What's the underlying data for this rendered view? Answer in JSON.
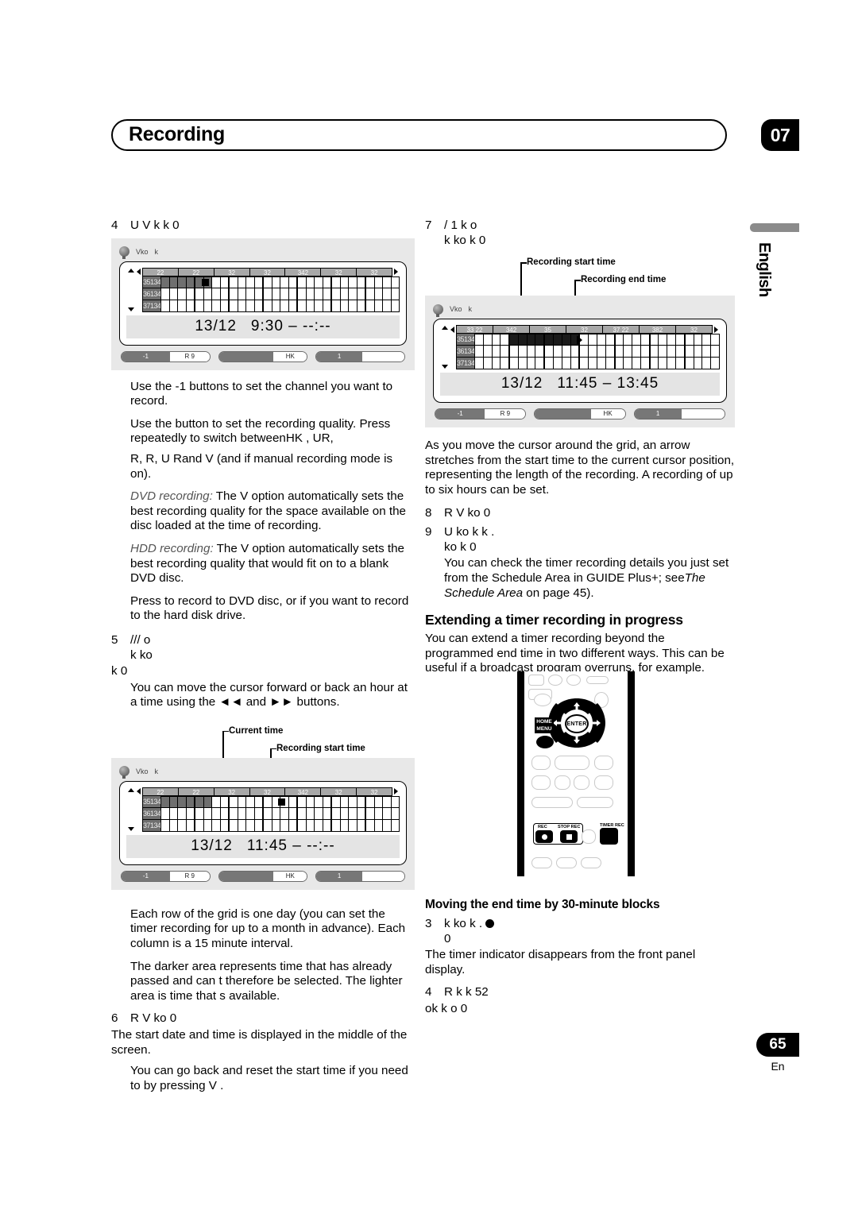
{
  "header": {
    "chapter_title": "Recording",
    "chapter_number": "07",
    "language_tab": "English"
  },
  "footer": {
    "page_number": "65",
    "page_language": "En"
  },
  "left_column": {
    "step4": {
      "number": "4",
      "text_line1": "U          V                                        k          k 0",
      "text_line2": ""
    },
    "figure1": {
      "titlebar_text1": "Vko",
      "titlebar_text2": "k",
      "header_cells": [
        "22",
        "22",
        "32",
        "32",
        "342",
        "32",
        "32"
      ],
      "row_labels": [
        "35134",
        "36134",
        "37134"
      ],
      "time_date": "13/12",
      "time_start": "9:30",
      "time_sep": "–",
      "time_end": "--:--",
      "buttons": [
        {
          "dark": "-1",
          "light": "R  9"
        },
        {
          "dark": "",
          "light": "HK"
        },
        {
          "dark": "1",
          "light": ""
        }
      ]
    },
    "p_channel": "Use the                           -1   buttons to set the channel you want to record.",
    "p_quality_a": "Use the                              button to set the recording quality. Press repeatedly to switch betweenHK   , UR,",
    "p_quality_b": "  R, R, U  Rand        V  (and          if manual recording mode is on).",
    "p_dvd_italic": "DVD recording:",
    "p_dvd_rest": " The        V   option automatically sets the best recording quality for the space available on the disc loaded at the time of recording.",
    "p_hdd_italic": "HDD recording:",
    "p_hdd_rest": " The        V   option automatically sets the best recording quality that would fit on to a blank DVD disc.",
    "p_press": "Press            to record to DVD disc, or          if you want to record to the hard disk drive.",
    "step5": {
      "number": "5",
      "text_line1": "///                                                                    o",
      "text_line2": "                                  k                                   ko",
      "text_line3": "k 0"
    },
    "p_cursor_hour": "You can move the cursor forward or back an hour at a time using the ◄◄ and ►► buttons.",
    "figure2": {
      "callout_current": "Current time",
      "callout_start": "Recording start time",
      "titlebar_text1": "Vko",
      "titlebar_text2": "k",
      "header_cells": [
        "22",
        "22",
        "32",
        "32",
        "342",
        "32",
        "32"
      ],
      "row_labels": [
        "35134",
        "36134",
        "37134"
      ],
      "time_date": "13/12",
      "time_start": "11:45",
      "time_sep": "–",
      "time_end": "--:--",
      "buttons": [
        {
          "dark": "-1",
          "light": "R  9"
        },
        {
          "dark": "",
          "light": "HK"
        },
        {
          "dark": "1",
          "light": ""
        }
      ]
    },
    "p_grid_row": "Each row of the grid is one day (you can set the timer recording for up to a month in advance). Each column is a 15 minute interval.",
    "p_darker": "The darker area represents time that has already passed and can t therefore be selected. The lighter area is time that s available.",
    "step6": {
      "number": "6",
      "text": "R              V                                            ko  0"
    },
    "p_startdate": "The start date and time is displayed in the middle of the screen.",
    "p_goback": "You can go back and reset the start time if you need to by pressing     V   ."
  },
  "right_column": {
    "step7": {
      "number": "7",
      "text_line1": "/                                          1 k                o",
      "text_line2": "                        k              ko                 k 0"
    },
    "figure3": {
      "callout_start": "Recording start time",
      "callout_end": "Recording end time",
      "titlebar_text1": "Vko",
      "titlebar_text2": "k",
      "header_cells": [
        "33 22",
        "342",
        "35",
        "32",
        "37 22",
        "382",
        "32"
      ],
      "row_labels": [
        "35134",
        "36134",
        "37134"
      ],
      "time_date": "13/12",
      "time_start": "11:45",
      "time_sep": "–",
      "time_end": "13:45",
      "buttons": [
        {
          "dark": "-1",
          "light": "R  9"
        },
        {
          "dark": "",
          "light": "HK"
        },
        {
          "dark": "1",
          "light": ""
        }
      ]
    },
    "p_cursor_arrow": "As you move the cursor around the grid, an arrow stretches from the start time to the current cursor position, representing the length of the recording. A recording of up to six hours can be set.",
    "step8": {
      "number": "8",
      "text": "R                V                                          ko  0"
    },
    "step9": {
      "number": "9",
      "text_line1": "U                                          ko                 k             k .",
      "text_line2": "                                ko                 k               0"
    },
    "p_schedule_a": "You can check the timer recording details you just set from the Schedule Area in GUIDE Plus+; see",
    "p_schedule_italic": "The Schedule Area",
    "p_schedule_b": " on page 45).",
    "heading_extending": "Extending a timer recording in progress",
    "p_extending": "You can extend a timer recording beyond the programmed end time in two different ways. This can be useful if a broadcast program overruns, for example.",
    "remote": {
      "enter_label": "ENTER",
      "home_label_line1": "HOME",
      "home_label_line2": "MENU",
      "rec_label": "REC",
      "stop_rec_label": "STOP REC",
      "timer_rec_label": "TIMER REC"
    },
    "heading_moving": "Moving the end time by 30-minute blocks",
    "step3": {
      "number": "3",
      "text_line1": "k     ko              k  .",
      "text_line2": "                       0"
    },
    "p_timer_indicator": "The timer indicator disappears from the front panel display.",
    "step4b": {
      "number": "4",
      "text_line1": "R                                                      k    k   52",
      "text_line2": "ok          k        o         0"
    }
  }
}
